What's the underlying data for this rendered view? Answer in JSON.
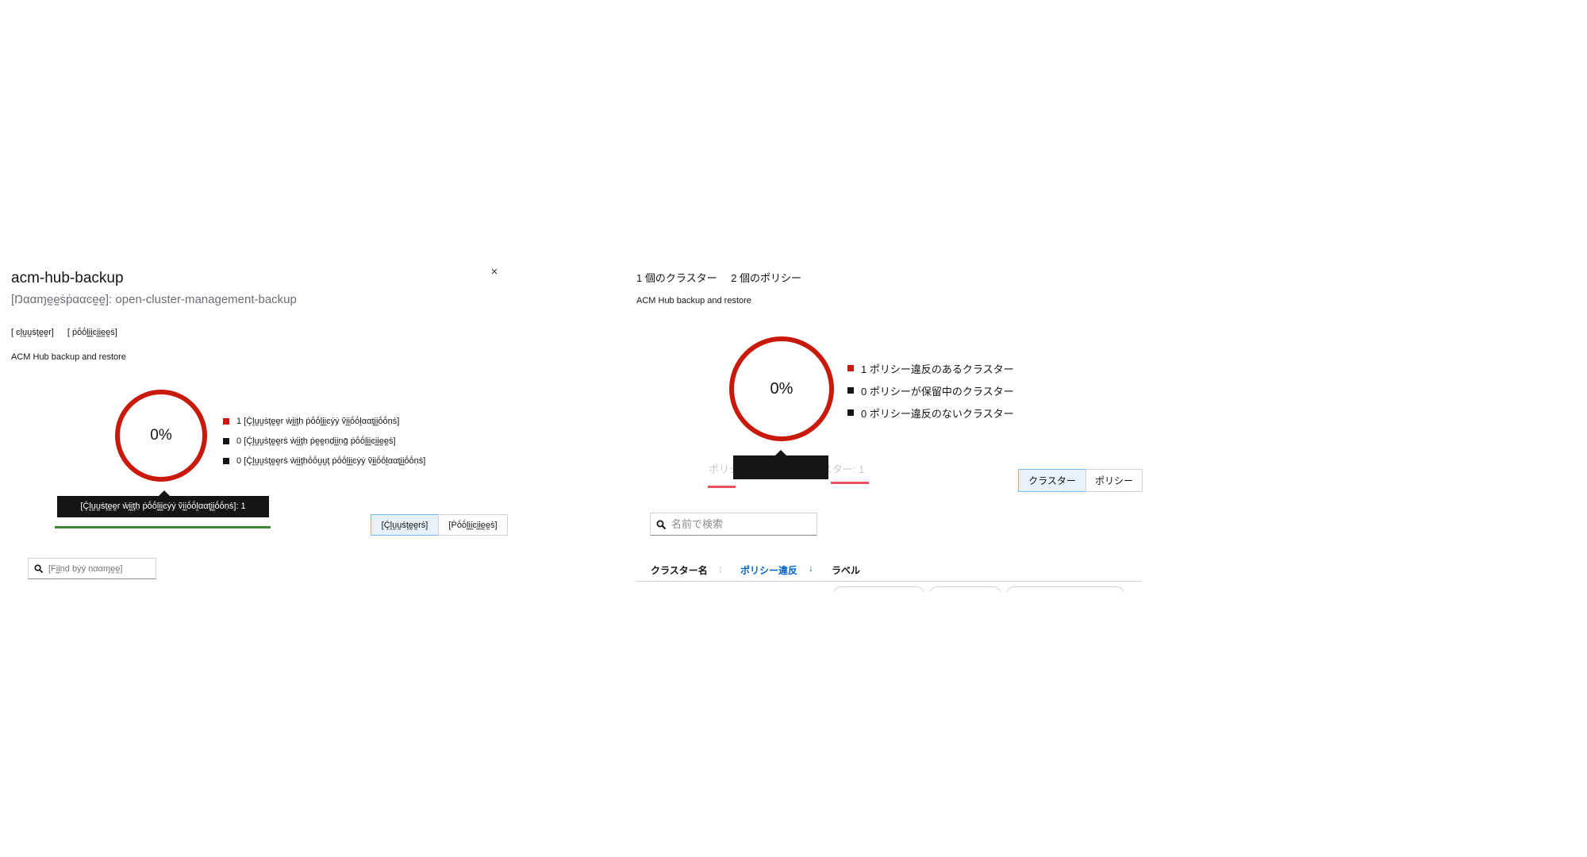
{
  "left_panel": {
    "title": "acm-hub-backup",
    "namespace_line": "[Ŋααɱḛḛṡṗααͼḛḛ]: open-cluster-management-backup",
    "close_symbol": "×",
    "counts": [
      "[ ͼḽṵṵṡţḛḛr]",
      "[ ṗṓṓḽḭḭͼḭḭḛḛṡ]"
    ],
    "description": "ACM Hub backup and restore",
    "donut": {
      "percent_label": "0%",
      "compliant_fraction": 0,
      "ring_color": "#c9190b"
    },
    "legend": [
      {
        "text": "1 [Ḉḽṵṵṡţḛḛr ẁḭḭţḥ ṗṓṓḽḭḭͼẏẏ ṽḭḭṓṓḽααţḭḭṓṓṇṡ]",
        "color": "#c9190b"
      },
      {
        "text": "0 [Ḉḽṵṵṡţḛḛrṡ ẁḭḭţḥ ṗḛḛṇḍḭḭṇḡ ṗṓṓḽḭḭͼḭḭḛḛṡ]",
        "color": "#151515"
      },
      {
        "text": "0 [Ḉḽṵṵṡţḛḛrṡ ẁḭḭţḥṓṓṵṵţ ṗṓṓḽḭḭͼẏẏ ṽḭḭṓṓḽααţḭḭṓṓṇṡ]",
        "color": "#151515"
      }
    ],
    "tooltip": "[Ḉḽṵṵṡţḛḛr ẁḭḭţḥ ṗṓṓḽḭḭͼẏẏ ṽḭḭṓṓḽααţḭḭṓṓṇṡ]: 1",
    "toggle": {
      "clusters": "[Ḉḽṵṵṡţḛḛrṡ]",
      "policies": "[Ṗṓṓḽḭḭͼḭḭḛḛṡ]"
    },
    "search": {
      "placeholder": "[Ḟḭḭṇḍ ḅẏẏ ṇααɱḛḛ]"
    }
  },
  "right_panel": {
    "counts": [
      "1 個のクラスター",
      "2 個のポリシー"
    ],
    "description": "ACM Hub backup and restore",
    "donut": {
      "percent_label": "0%",
      "compliant_fraction": 0,
      "ring_color": "#c9190b"
    },
    "legend": [
      {
        "text": "1 ポリシー違反のあるクラスター",
        "color": "#c9190b"
      },
      {
        "text": "0 ポリシーが保留中のクラスター",
        "color": "#151515"
      },
      {
        "text": "0 ポリシー違反のないクラスター",
        "color": "#151515"
      }
    ],
    "tooltip": "ポリシー違反のあるクラスター: 1",
    "toggle": {
      "clusters": "クラスター",
      "policies": "ポリシー"
    },
    "search": {
      "placeholder": "名前で検索"
    },
    "table_headers": {
      "cluster_name": "クラスター名",
      "policy_violations": "ポリシー違反",
      "labels": "ラベル"
    }
  },
  "icons": {
    "search": "search-icon",
    "close": "close-icon",
    "sort_neutral": "sort-icon",
    "sort_desc": "sort-down-icon"
  },
  "colors": {
    "violation_red": "#c9190b",
    "selected_toggle_bg": "#e7f1fa",
    "selected_toggle_border": "#73bcf7",
    "link_blue": "#0066cc",
    "success_green": "#3e8635",
    "tooltip_bg": "#151515"
  }
}
